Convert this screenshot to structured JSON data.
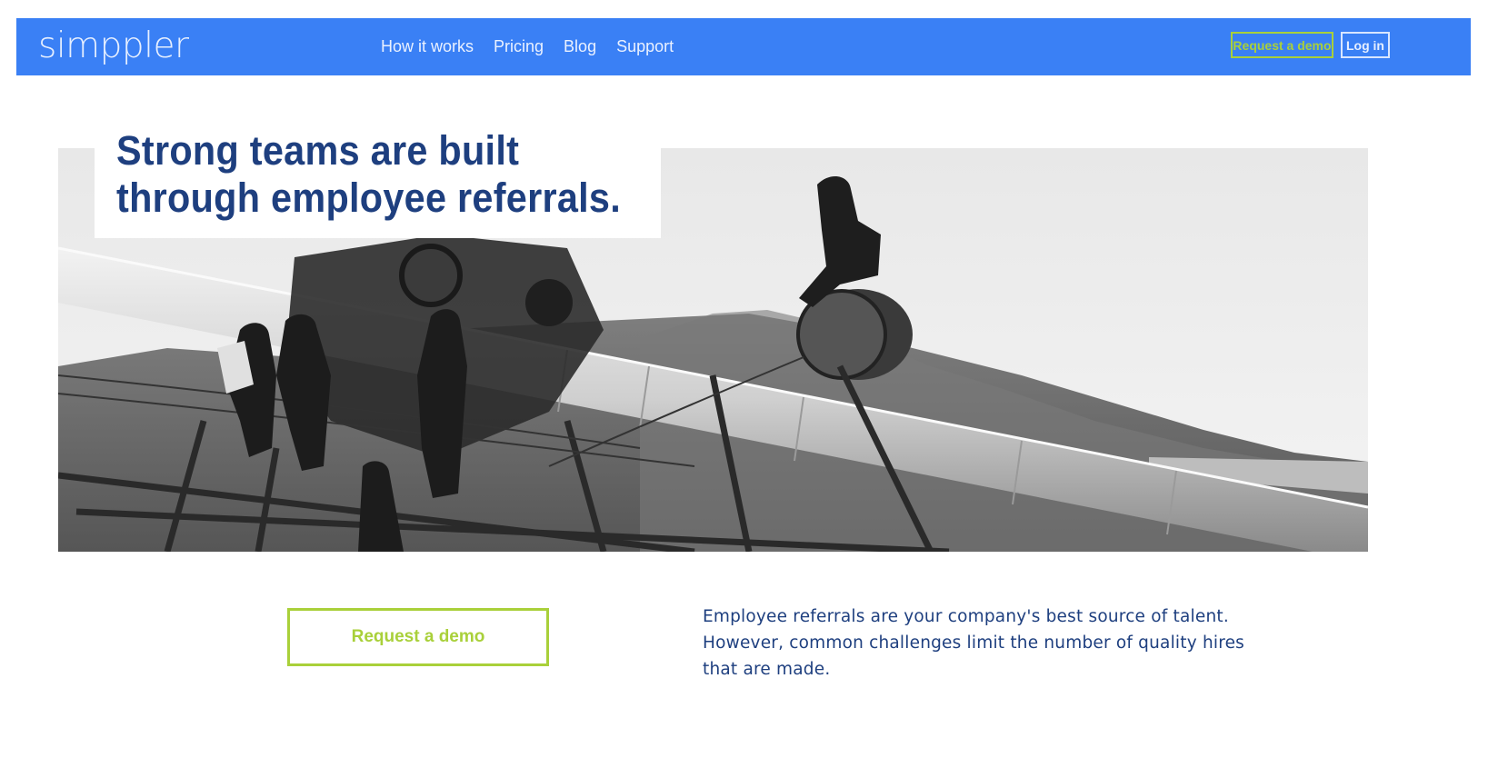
{
  "brand": {
    "logo_text": "simppler"
  },
  "nav": {
    "links": [
      "How it works",
      "Pricing",
      "Blog",
      "Support"
    ],
    "request_demo_label": "Request a demo",
    "login_label": "Log in"
  },
  "hero": {
    "headline_line1": "Strong teams are built",
    "headline_line2": "through employee referrals.",
    "image_subject": "black-and-white photo of workers on a bridge cable construction"
  },
  "cta": {
    "label": "Request a demo"
  },
  "description": {
    "line1": "Employee referrals are your company's best source of talent.",
    "line2": "However, common challenges limit the number of quality hires",
    "line3": "that are made."
  },
  "colors": {
    "nav_bg": "#3a80f5",
    "accent_green": "#a9d03a",
    "headline_navy": "#1e3f7f"
  }
}
